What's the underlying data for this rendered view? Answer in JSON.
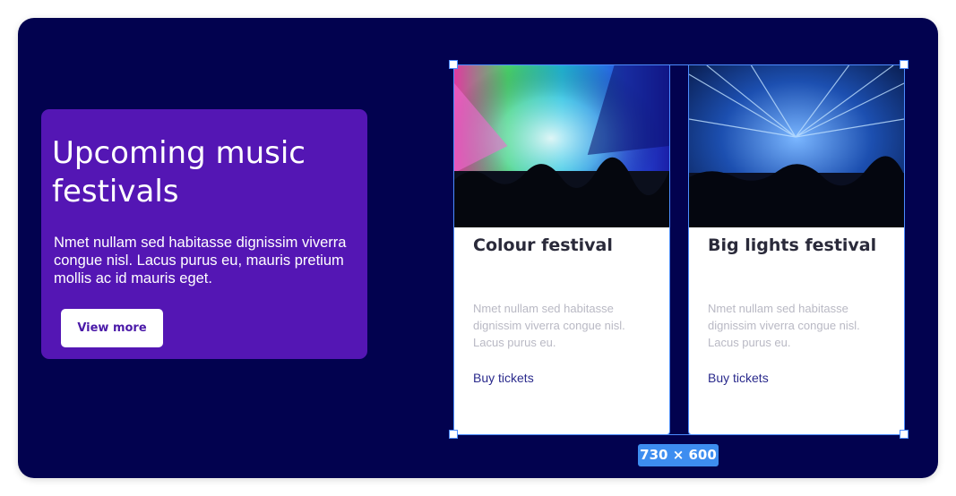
{
  "hero": {
    "title": "Upcoming music festivals",
    "text": "Nmet nullam sed habitasse dignissim viverra congue nisl. Lacus purus eu, mauris pretium mollis ac id mauris eget.",
    "button_label": "View more"
  },
  "cards": [
    {
      "title": "Colour festival",
      "description": "Nmet nullam sed habitasse dignissim viverra congue nisl. Lacus purus eu.",
      "link_label": "Buy tickets",
      "image": "concert-crowd-colorful-image"
    },
    {
      "title": "Big lights festival",
      "description": "Nmet nullam sed habitasse dignissim viverra congue nisl. Lacus purus eu.",
      "link_label": "Buy tickets",
      "image": "concert-laser-lights-image"
    }
  ],
  "selection": {
    "size_label": "730 × 600"
  },
  "colors": {
    "background": "#02024f",
    "hero_card": "#5416b4",
    "selection": "#4c8cff",
    "link": "#2a2a8c"
  }
}
